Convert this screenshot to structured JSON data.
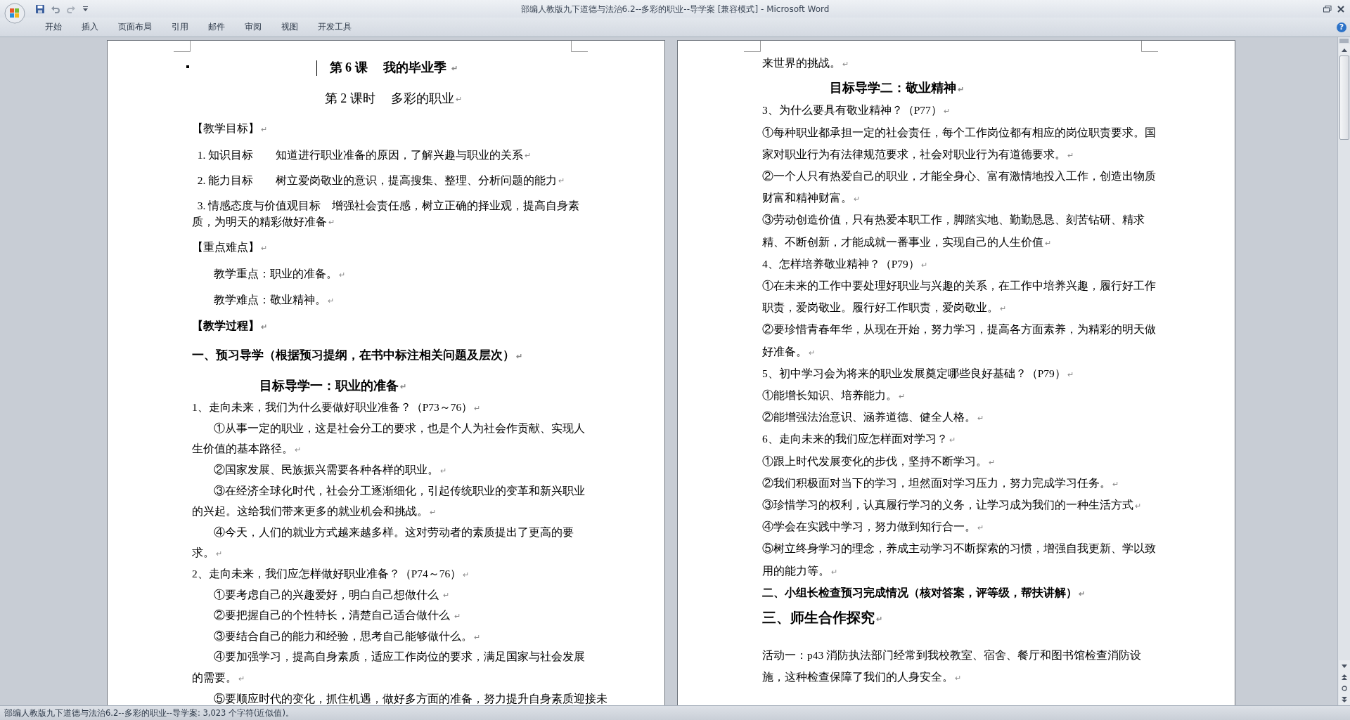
{
  "window": {
    "title": "部编人教版九下道德与法治6.2--多彩的职业--导学案 [兼容模式] - Microsoft Word"
  },
  "ribbon_tabs": [
    {
      "label": "开始",
      "selected": false
    },
    {
      "label": "插入",
      "selected": false
    },
    {
      "label": "页面布局",
      "selected": false
    },
    {
      "label": "引用",
      "selected": false
    },
    {
      "label": "邮件",
      "selected": false
    },
    {
      "label": "审阅",
      "selected": false
    },
    {
      "label": "视图",
      "selected": false
    },
    {
      "label": "开发工具",
      "selected": false
    }
  ],
  "help": "?",
  "pages": [
    {
      "paragraphs": [
        {
          "kind": "title",
          "text": "第 6 课　 我的毕业季 ",
          "mark": "↵",
          "cursor": true,
          "bullet": true
        },
        {
          "kind": "subtitle",
          "text": "第 2 课时　 多彩的职业",
          "mark": "↵"
        },
        {
          "kind": "section",
          "text": "【教学目标】",
          "mark": "↵"
        },
        {
          "kind": "objective",
          "text": "1. 知识目标　　知道进行职业准备的原因，了解兴趣与职业的关系",
          "mark": "↵"
        },
        {
          "kind": "objective",
          "text": "2. 能力目标　　树立爱岗敬业的意识，提高搜集、整理、分析问题的能力",
          "mark": "↵"
        },
        {
          "kind": "objective",
          "text": "3. 情感态度与价值观目标　增强社会责任感，树立正确的择业观，提高自身素质，为明天的精彩做好准备",
          "mark": "↵"
        },
        {
          "kind": "section",
          "text": "【重点难点】",
          "mark": "↵"
        },
        {
          "kind": "keypoint",
          "text": "教学重点：职业的准备。",
          "mark": "↵"
        },
        {
          "kind": "keypoint",
          "text": "教学难点：敬业精神。",
          "mark": "↵"
        },
        {
          "kind": "section-bold",
          "text": "【教学过程】",
          "mark": "↵"
        },
        {
          "kind": "heading",
          "text": "一、预习导学（根据预习提纲，在书中标注相关问题及层次）",
          "mark": "↵"
        },
        {
          "kind": "subheading",
          "text": "目标导学一：职业的准备",
          "mark": "↵"
        },
        {
          "kind": "body",
          "text": "1、走向未来，我们为什么要做好职业准备？（P73～76）",
          "mark": "↵"
        },
        {
          "kind": "indented",
          "text": "①从事一定的职业，这是社会分工的要求，也是个人为社会作贡献、实现人生价值的基本路径。",
          "mark": "↵"
        },
        {
          "kind": "indented",
          "text": "②国家发展、民族振兴需要各种各样的职业。",
          "mark": "↵"
        },
        {
          "kind": "indented",
          "text": "③在经济全球化时代，社会分工逐渐细化，引起传统职业的变革和新兴职业的兴起。这给我们带来更多的就业机会和挑战。",
          "mark": "↵"
        },
        {
          "kind": "indented",
          "text": "④今天，人们的就业方式越来越多样。这对劳动者的素质提出了更高的要求。",
          "mark": "↵"
        },
        {
          "kind": "body",
          "text": "2、走向未来，我们应怎样做好职业准备？（P74～76）",
          "mark": "↵"
        },
        {
          "kind": "indented",
          "text": "①要考虑自己的兴趣爱好，明白自己想做什么 ",
          "mark": "↵"
        },
        {
          "kind": "indented",
          "text": "②要把握自己的个性特长，清楚自己适合做什么 ",
          "mark": "↵"
        },
        {
          "kind": "indented",
          "text": "③要结合自己的能力和经验，思考自己能够做什么。",
          "mark": "↵"
        },
        {
          "kind": "indented",
          "text": "④要加强学习，提高自身素质，适应工作岗位的要求，满足国家与社会发展的需要。",
          "mark": "↵"
        },
        {
          "kind": "indented-cut",
          "text": "⑤要顺应时代的变化，抓住机遇，做好多方面的准备，努力提升自身素质迎接未"
        }
      ]
    },
    {
      "paragraphs": [
        {
          "kind": "body",
          "text": "来世界的挑战。",
          "mark": "↵"
        },
        {
          "kind": "subheading",
          "text": "目标导学二：敬业精神",
          "mark": "↵"
        },
        {
          "kind": "body",
          "text": "3、为什么要具有敬业精神？（P77）",
          "mark": "↵"
        },
        {
          "kind": "body",
          "text": "①每种职业都承担一定的社会责任，每个工作岗位都有相应的岗位职责要求。国家对职业行为有法律规范要求，社会对职业行为有道德要求。",
          "mark": "↵"
        },
        {
          "kind": "body",
          "text": "②一个人只有热爱自己的职业，才能全身心、富有激情地投入工作，创造出物质财富和精神财富。",
          "mark": "↵"
        },
        {
          "kind": "body",
          "text": "③劳动创造价值，只有热爱本职工作，脚踏实地、勤勤恳恳、刻苦钻研、精求精、不断创新，才能成就一番事业，实现自己的人生价值",
          "mark": "↵"
        },
        {
          "kind": "body",
          "text": "4、怎样培养敬业精神？（P79）",
          "mark": "↵"
        },
        {
          "kind": "body",
          "text": "①在未来的工作中要处理好职业与兴趣的关系，在工作中培养兴趣，履行好工作职责，爱岗敬业。履行好工作职责，爱岗敬业。",
          "mark": "↵"
        },
        {
          "kind": "body",
          "text": "②要珍惜青春年华，从现在开始，努力学习，提高各方面素养，为精彩的明天做好准备。",
          "mark": "↵"
        },
        {
          "kind": "body",
          "text": "5、初中学习会为将来的职业发展奠定哪些良好基础？（P79）",
          "mark": "↵"
        },
        {
          "kind": "body",
          "text": "①能增长知识、培养能力。",
          "mark": "↵"
        },
        {
          "kind": "body",
          "text": "②能增强法治意识、涵养道德、健全人格。",
          "mark": "↵"
        },
        {
          "kind": "body",
          "text": "6、走向未来的我们应怎样面对学习？",
          "mark": "↵"
        },
        {
          "kind": "body",
          "text": "①跟上时代发展变化的步伐，坚持不断学习。",
          "mark": "↵"
        },
        {
          "kind": "body",
          "text": "②我们积极面对当下的学习，坦然面对学习压力，努力完成学习任务。",
          "mark": "↵"
        },
        {
          "kind": "body",
          "text": "③珍惜学习的权利，认真履行学习的义务，让学习成为我们的一种生活方式",
          "mark": "↵"
        },
        {
          "kind": "body",
          "text": "④学会在实践中学习，努力做到知行合一。",
          "mark": "↵"
        },
        {
          "kind": "body",
          "text": "⑤树立终身学习的理念，养成主动学习不断探索的习惯，增强自我更新、学以致用的能力等。",
          "mark": "↵"
        },
        {
          "kind": "bold-body",
          "text": "二、小组长检查预习完成情况（核对答案，评等级，帮扶讲解）",
          "mark": "↵"
        },
        {
          "kind": "heading-large",
          "text": "三、师生合作探究",
          "mark": "↵"
        },
        {
          "kind": "activity",
          "text": "活动一：p43 消防执法部门经常到我校教室、宿舍、餐厅和图书馆检查消防设施，这种检查保障了我们的人身安全。",
          "mark": "↵"
        }
      ]
    }
  ],
  "status_bar": {
    "text": "部编人教版九下道德与法治6.2--多彩的职业--导学案: 3,023 个字符(近似值)。"
  }
}
